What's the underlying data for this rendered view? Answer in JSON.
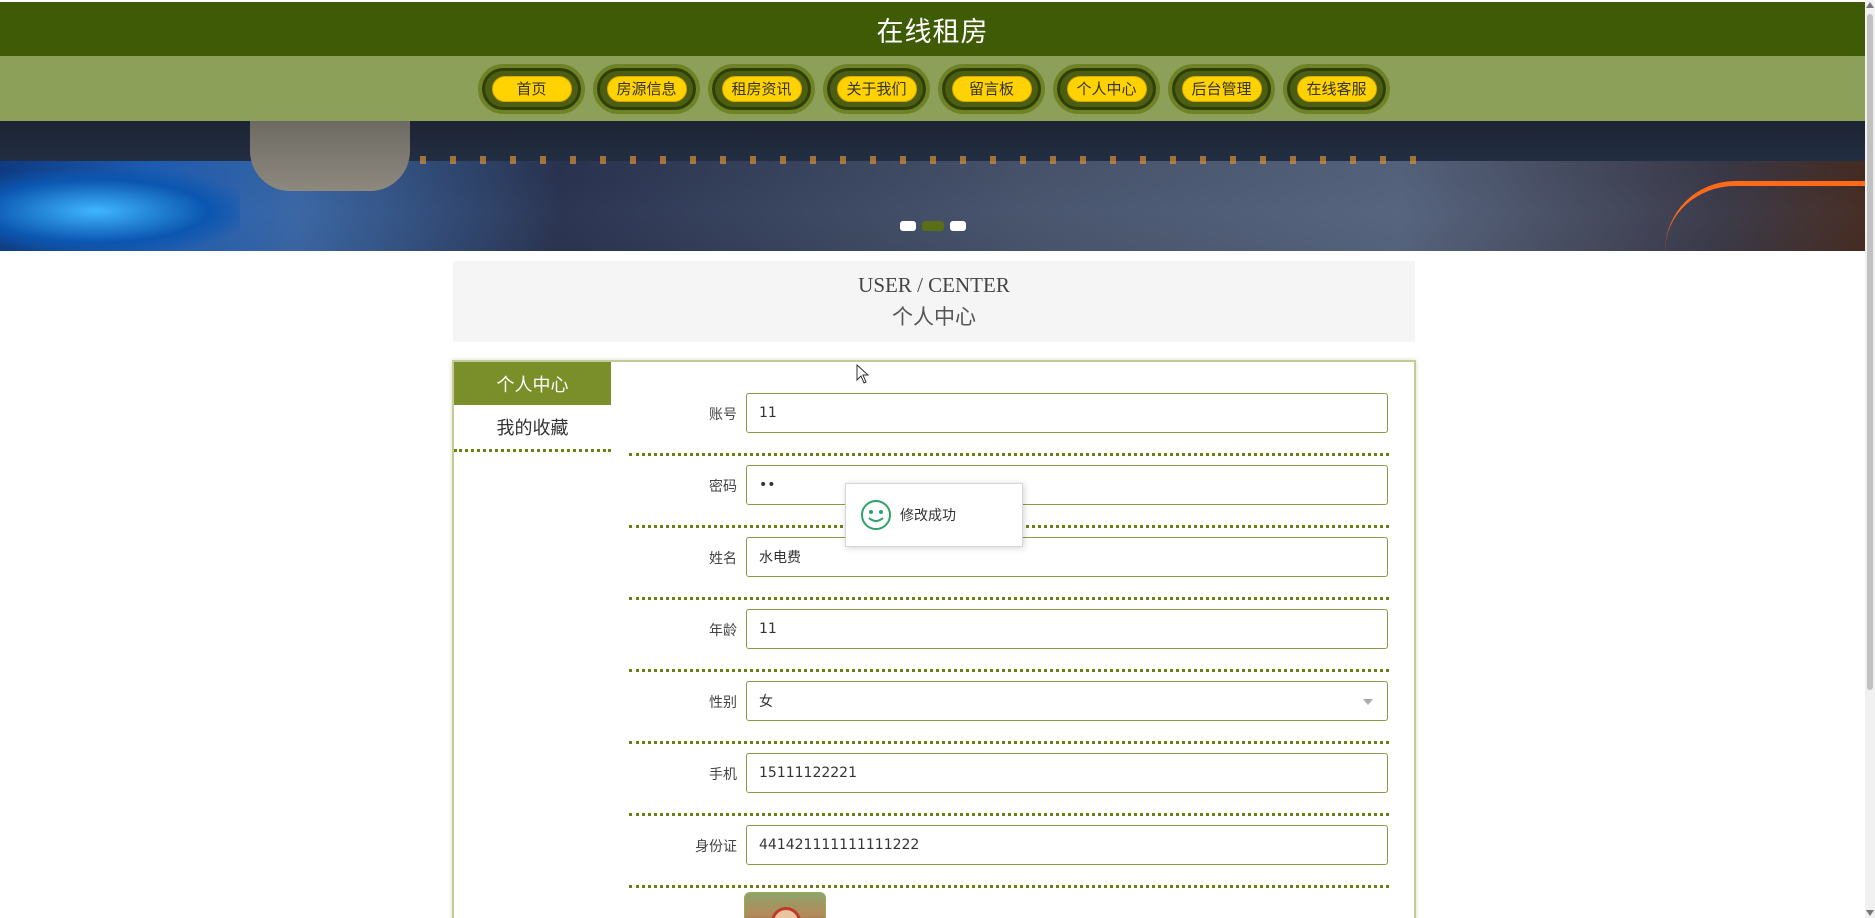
{
  "header": {
    "title": "在线租房"
  },
  "nav": {
    "items": [
      {
        "label": "首页"
      },
      {
        "label": "房源信息"
      },
      {
        "label": "租房资讯"
      },
      {
        "label": "关于我们"
      },
      {
        "label": "留言板"
      },
      {
        "label": "个人中心"
      },
      {
        "label": "后台管理"
      },
      {
        "label": "在线客服"
      }
    ]
  },
  "banner": {
    "active_dot": 2,
    "dot_count": 3
  },
  "section": {
    "en": "USER / CENTER",
    "cn": "个人中心"
  },
  "sidemenu": {
    "items": [
      {
        "label": "个人中心",
        "active": true
      },
      {
        "label": "我的收藏",
        "active": false
      }
    ]
  },
  "form": {
    "account": {
      "label": "账号",
      "value": "11"
    },
    "password": {
      "label": "密码",
      "value": "••"
    },
    "name": {
      "label": "姓名",
      "value": "水电费"
    },
    "age": {
      "label": "年龄",
      "value": "11"
    },
    "gender": {
      "label": "性别",
      "value": "女"
    },
    "phone": {
      "label": "手机",
      "value": "15111122221"
    },
    "idcard": {
      "label": "身份证",
      "value": "441421111111111222"
    }
  },
  "toast": {
    "message": "修改成功",
    "icon": "smile-icon"
  },
  "colors": {
    "header_bg": "#3f5b06",
    "nav_bg": "#8ca05a",
    "nav_pill": "#ffd200",
    "accent": "#7a8e2a"
  }
}
